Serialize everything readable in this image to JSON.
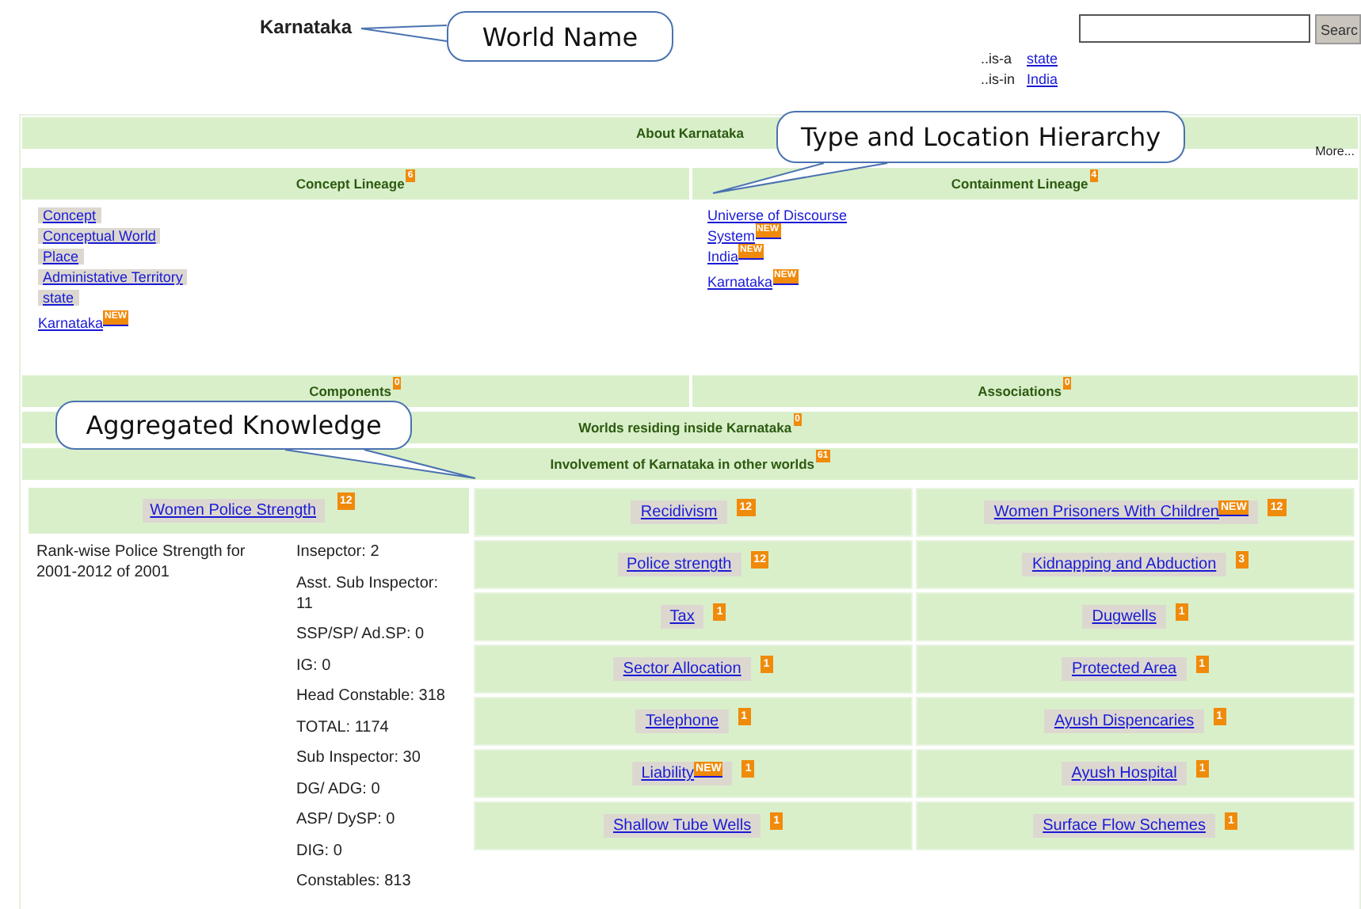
{
  "world": {
    "title": "Karnataka"
  },
  "search": {
    "button": "Searc"
  },
  "relations": [
    {
      "label": "..is-a",
      "value": "state"
    },
    {
      "label": "..is-in",
      "value": "India"
    }
  ],
  "about": {
    "title": "About Karnataka",
    "more": "More..."
  },
  "concept_lineage": {
    "title": "Concept Lineage",
    "count": "6",
    "items": [
      {
        "label": "Concept",
        "shaded": true
      },
      {
        "label": "Conceptual World",
        "shaded": true
      },
      {
        "label": "Place",
        "shaded": true
      },
      {
        "label": "Administative Territory",
        "shaded": true
      },
      {
        "label": "state",
        "shaded": true
      },
      {
        "label": "Karnataka",
        "badge": "NEW",
        "shaded": false
      }
    ]
  },
  "containment_lineage": {
    "title": "Containment Lineage",
    "count": "4",
    "items": [
      {
        "label": "Universe of Discourse",
        "shaded": false
      },
      {
        "label": "System",
        "badge": "NEW",
        "shaded": false
      },
      {
        "label": "India",
        "badge": "NEW",
        "shaded": false
      },
      {
        "label": "Karnataka",
        "badge": "NEW",
        "shaded": false
      }
    ]
  },
  "components": {
    "title": "Components",
    "count": "0"
  },
  "associations": {
    "title": "Associations",
    "count": "0"
  },
  "worlds_residing": {
    "title": "Worlds residing inside Karnataka",
    "count": "0"
  },
  "involvement": {
    "title": "Involvement of Karnataka in other worlds",
    "count": "61",
    "featured": {
      "label": "Women Police Strength",
      "count": "12",
      "description": "Rank-wise Police Strength for 2001-2012 of 2001",
      "values": [
        "Insepctor: 2",
        "Asst. Sub Inspector: 11",
        "SSP/SP/ Ad.SP: 0",
        "IG: 0",
        "Head Constable: 318",
        "TOTAL: 1174",
        "Sub Inspector: 30",
        "DG/ ADG: 0",
        "ASP/ DySP: 0",
        "DIG: 0",
        "Constables: 813"
      ]
    },
    "items": [
      {
        "label": "Recidivism",
        "count": "12"
      },
      {
        "label": "Women Prisoners With Children",
        "badge": "NEW",
        "count": "12"
      },
      {
        "label": "Police strength",
        "count": "12"
      },
      {
        "label": "Kidnapping and Abduction",
        "count": "3"
      },
      {
        "label": "Tax",
        "count": "1"
      },
      {
        "label": "Dugwells",
        "count": "1"
      },
      {
        "label": "Sector Allocation",
        "count": "1"
      },
      {
        "label": "Protected Area",
        "count": "1"
      },
      {
        "label": "Telephone",
        "count": "1"
      },
      {
        "label": "Ayush Dispencaries",
        "count": "1"
      },
      {
        "label": "Liability",
        "badge": "NEW",
        "count": "1"
      },
      {
        "label": "Ayush Hospital",
        "count": "1"
      },
      {
        "label": "Shallow Tube Wells",
        "count": "1"
      },
      {
        "label": "Surface Flow Schemes",
        "count": "1"
      }
    ]
  },
  "callouts": [
    "World Name",
    "Type and Location Hierarchy",
    "Aggregated Knowledge"
  ]
}
